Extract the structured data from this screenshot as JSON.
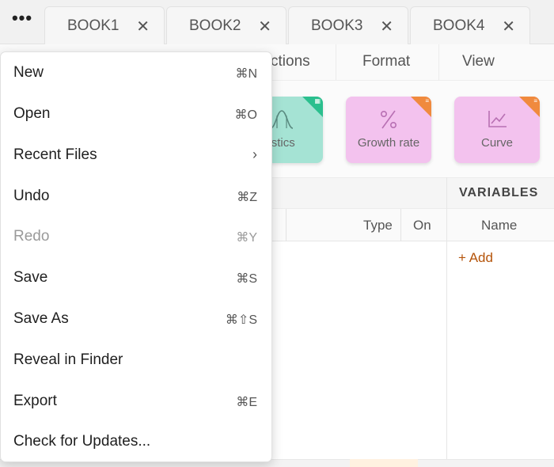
{
  "tabs": [
    {
      "label": "BOOK1"
    },
    {
      "label": "BOOK2"
    },
    {
      "label": "BOOK3"
    },
    {
      "label": "BOOK4"
    }
  ],
  "menubar": {
    "items": [
      {
        "label": "ctions"
      },
      {
        "label": "Format"
      },
      {
        "label": "View"
      }
    ]
  },
  "ribbon": {
    "tools": [
      {
        "label": "tistics",
        "icon": "distribution-curve-icon",
        "bg": "#a5e3d4",
        "corner": "#2bbf8e"
      },
      {
        "label": "Growth rate",
        "icon": "percent-icon",
        "bg": "#f3c2ee",
        "corner": "#f08a3e"
      },
      {
        "label": "Curve",
        "icon": "line-chart-icon",
        "bg": "#f3c2ee",
        "corner": "#f08a3e"
      }
    ]
  },
  "variables": {
    "title": "VARIABLES",
    "name_header": "Name",
    "add_label": "+ Add"
  },
  "table": {
    "headers": {
      "type": "Type",
      "on": "On"
    }
  },
  "menu": {
    "items": [
      {
        "label": "New",
        "shortcut": "⌘N",
        "enabled": true
      },
      {
        "label": "Open",
        "shortcut": "⌘O",
        "enabled": true
      },
      {
        "label": "Recent Files",
        "shortcut": "›",
        "enabled": true
      },
      {
        "label": "Undo",
        "shortcut": "⌘Z",
        "enabled": true
      },
      {
        "label": "Redo",
        "shortcut": "⌘Y",
        "enabled": false
      },
      {
        "label": "Save",
        "shortcut": "⌘S",
        "enabled": true
      },
      {
        "label": "Save As",
        "shortcut": "⌘⇧S",
        "enabled": true
      },
      {
        "label": "Reveal in Finder",
        "shortcut": "",
        "enabled": true
      },
      {
        "label": "Export",
        "shortcut": "⌘E",
        "enabled": true
      },
      {
        "label": "Check for Updates...",
        "shortcut": "",
        "enabled": true
      }
    ]
  },
  "colors": {
    "accent_link": "#b45309",
    "disabled_text": "#9a9a9a"
  }
}
